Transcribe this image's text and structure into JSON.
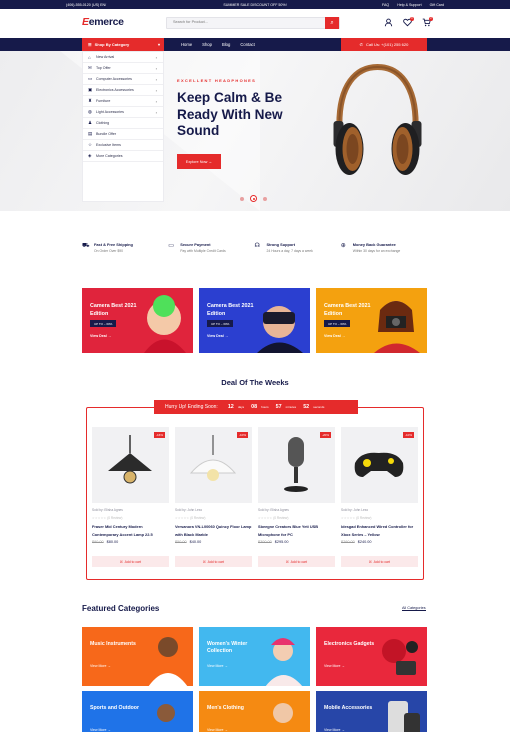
{
  "topbar": {
    "phone": "(406)-555-0120 (US) EN/",
    "promo": "SUMMER SALE DISCOUNT OFF 50%!",
    "links": [
      "FAQ",
      "Help & Support",
      "Gift Card"
    ]
  },
  "header": {
    "logo_prefix": "E",
    "logo_rest": "emerce",
    "search_placeholder": "Search for Product...",
    "cart_count": "2",
    "wishlist_count": "0"
  },
  "nav": {
    "category_label": "Shop By Category",
    "links": [
      "Home",
      "Shop",
      "Blog",
      "Contact"
    ],
    "call_label": "Call Us: +(101) 255 620"
  },
  "categories": [
    {
      "label": "New Arrival",
      "icon": "tag-icon",
      "arrow": true
    },
    {
      "label": "Top Offer",
      "icon": "gift-icon",
      "arrow": true
    },
    {
      "label": "Computer Accessories",
      "icon": "monitor-icon",
      "arrow": true
    },
    {
      "label": "Electronics Accessories",
      "icon": "tv-icon",
      "arrow": true
    },
    {
      "label": "Furniture",
      "icon": "chair-icon",
      "arrow": true
    },
    {
      "label": "Light Accessories",
      "icon": "bulb-icon",
      "arrow": true
    },
    {
      "label": "Clothing",
      "icon": "shirt-icon",
      "arrow": false
    },
    {
      "label": "Bundle Offer",
      "icon": "bag-icon",
      "arrow": false
    },
    {
      "label": "Exclusive Items",
      "icon": "star-icon",
      "arrow": false
    },
    {
      "label": "More Categories",
      "icon": "grid-icon",
      "arrow": false
    }
  ],
  "hero": {
    "eyebrow": "EXCELLENT HEADPHONES",
    "title": "Keep Calm & Be Ready With New Sound",
    "button": "Explore Now →"
  },
  "features": [
    {
      "title": "Fast & Free Shipping",
      "sub": "On Order Over $90",
      "icon": "truck-icon"
    },
    {
      "title": "Secure Payment",
      "sub": "Pay with Multiple Credit Cards",
      "icon": "card-icon"
    },
    {
      "title": "Strong Support",
      "sub": "24 Hours a day, 7 days a week",
      "icon": "headset-icon"
    },
    {
      "title": "Money Back Guarantee",
      "sub": "Within 30 days for an exchange",
      "icon": "money-icon"
    }
  ],
  "banners": [
    {
      "title": "Camera Best 2021 Edition",
      "tag": "UP TO – 60%",
      "link": "View Deal →",
      "color": "#e0243c"
    },
    {
      "title": "Camera Best 2021 Edition",
      "tag": "UP TO – 60%",
      "link": "View Deal →",
      "color": "#2b3fd0"
    },
    {
      "title": "Camera Best 2021 Edition",
      "tag": "UP TO – 60%",
      "link": "View Deal →",
      "color": "#f4a10f"
    }
  ],
  "deal": {
    "title": "Deal Of The Weeks",
    "hurry": "Hurry Up! Ending Soon:",
    "timer": [
      {
        "value": "12",
        "unit": "days"
      },
      {
        "value": "08",
        "unit": "hours"
      },
      {
        "value": "57",
        "unit": "minutes"
      },
      {
        "value": "52",
        "unit": "seconds"
      }
    ],
    "add_to_cart": "Add to cart",
    "products": [
      {
        "discount": "-16%",
        "sold_by": "Sold by:",
        "seller": "Elisha Agnes",
        "reviews": "(0 Review)",
        "name": "Fraser Mid Century Modern Contemporary Accent Lamp 22.5",
        "old_price": "$90.00",
        "price": "$80.00"
      },
      {
        "discount": "-10%",
        "sold_by": "Sold by:",
        "seller": "John Lexo",
        "reviews": "(0 Review)",
        "name": "Versanora VN-L00060 Quincy Floor Lamp with Black Marble",
        "old_price": "$50.00",
        "price": "$40.00"
      },
      {
        "discount": "-20%",
        "sold_by": "Sold by:",
        "seller": "Elisha Agnes",
        "reviews": "(0 Review)",
        "name": "Sbeegne Creators Blue Yeti USB Microphone for PC",
        "old_price": "$300.00",
        "price": "$295.00"
      },
      {
        "discount": "-10%",
        "sold_by": "Sold by:",
        "seller": "John Lexo",
        "reviews": "(0 Review)",
        "name": "Idesgad Enhanced Wired Controller for Xbox Series – Yellow",
        "old_price": "$260.00",
        "price": "$240.00"
      }
    ]
  },
  "featured": {
    "title": "Featured Categories",
    "all_link": "All Categories",
    "view_more": "View More →",
    "items": [
      {
        "title": "Music Instruments",
        "color": "#f7681a"
      },
      {
        "title": "Women's Winter Collection",
        "color": "#42b8ef"
      },
      {
        "title": "Electronics Gadgets",
        "color": "#e9283c"
      },
      {
        "title": "Sports and Outdoor",
        "color": "#1f73e8"
      },
      {
        "title": "Men's Clothing",
        "color": "#f58a12"
      },
      {
        "title": "Mobile Accessories",
        "color": "#2746a8"
      }
    ]
  }
}
